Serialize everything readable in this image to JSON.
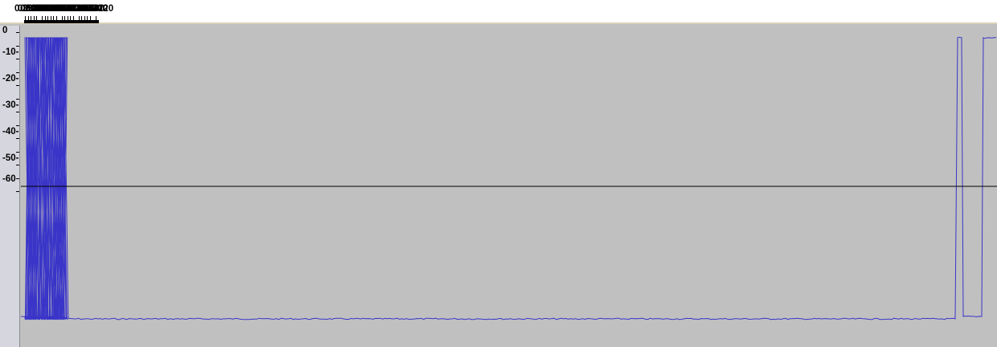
{
  "timeline": {
    "labels": [
      "0.3970",
      "0.3980",
      "0.3990",
      "0.4000",
      "0.4010",
      "0.4030",
      "0.4040",
      "0.4050",
      "0.4060",
      "0.4070",
      "0.4080",
      "0.4100",
      "0.4110",
      "0.4120",
      "0.4130",
      "0.4140",
      "0.4160",
      "0.4170",
      "0.4180",
      "0.4190",
      "0.4200",
      "0.4220"
    ]
  },
  "vertical_scale": {
    "labels": [
      "0",
      "-10-",
      "-20-",
      "-30-",
      "-40-",
      "-50-",
      "-60"
    ]
  },
  "colors": {
    "waveform": "#3a35c8",
    "track_background": "#c0c0c0",
    "threshold_line": "#000000"
  },
  "signal": {
    "type": "square_wave",
    "unit": "seconds",
    "high_intervals": [
      [
        0.39762,
        0.39772
      ],
      [
        0.39792,
        0.39821
      ],
      [
        0.39832,
        0.39842
      ],
      [
        0.39861,
        0.39892
      ],
      [
        0.39902,
        0.39912
      ],
      [
        0.39932,
        0.39961
      ],
      [
        0.39972,
        0.39981
      ],
      [
        0.40002,
        0.40031
      ],
      [
        0.40041,
        0.40051
      ],
      [
        0.40071,
        0.40101
      ],
      [
        0.40111,
        0.40122
      ],
      [
        0.40142,
        0.40182
      ],
      [
        0.40202,
        0.40221
      ],
      [
        0.40241,
        0.40251
      ],
      [
        0.40272,
        0.40311
      ],
      [
        0.40332,
        0.40361
      ],
      [
        0.40382,
        0.40391
      ],
      [
        0.40402,
        0.40421
      ],
      [
        0.40442,
        0.40451
      ],
      [
        0.40472,
        0.40501
      ],
      [
        0.40522,
        0.40541
      ],
      [
        0.40552,
        0.40592
      ],
      [
        0.40612,
        0.40622
      ],
      [
        0.40642,
        0.40681
      ],
      [
        0.40702,
        0.40712
      ],
      [
        0.40741,
        0.40751
      ],
      [
        0.40771,
        0.40802
      ],
      [
        0.40812,
        0.40822
      ],
      [
        0.40842,
        0.40872
      ],
      [
        0.40882,
        0.40892
      ],
      [
        0.40912,
        0.40932
      ],
      [
        0.40952,
        0.40961
      ],
      [
        0.40982,
        0.41011
      ],
      [
        0.41022,
        0.41031
      ],
      [
        0.41052,
        0.41081
      ],
      [
        0.41092,
        0.41111
      ],
      [
        0.41131,
        0.41161
      ]
    ]
  }
}
